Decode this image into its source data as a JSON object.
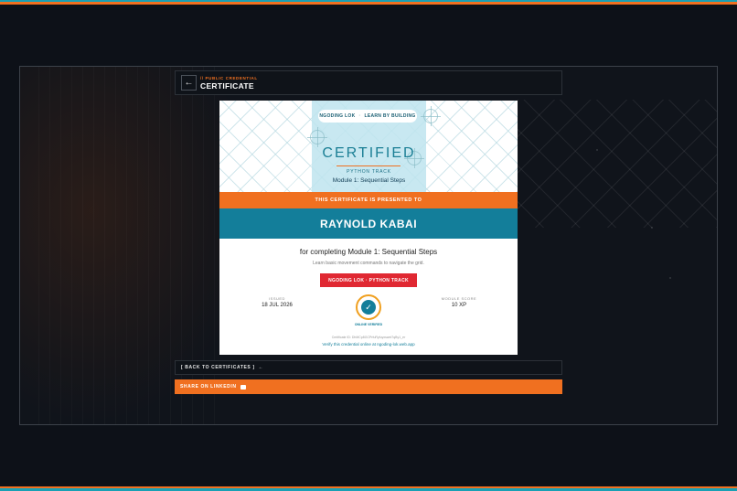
{
  "header": {
    "back_icon": "arrow-left-icon",
    "kicker": "// PUBLIC CREDENTIAL",
    "title": "CERTIFICATE"
  },
  "certificate": {
    "brand_name": "NGODING LOK",
    "brand_separator": "·",
    "brand_tagline": "LEARN BY BUILDING",
    "certified": "CERTIFIED",
    "track": "PYTHON TRACK",
    "module": "Module 1: Sequential Steps",
    "presented_to": "THIS CERTIFICATE IS PRESENTED TO",
    "recipient": "RAYNOLD KABAI",
    "completing": "for completing Module 1: Sequential Steps",
    "description": "Learn basic movement commands to navigate the grid.",
    "track_badge": "NGODING LOK · PYTHON TRACK",
    "issued_label": "ISSUED",
    "issued_value": "18 JUL 2026",
    "score_label": "MODULE SCORE",
    "score_value": "10 XP",
    "seal_icon": "verified-check-icon",
    "online_verified": "ONLINE VERIFIED",
    "certificate_id": "Certificate ID: DhMCp8GCPrfuRyfuyxswnt7qBy1_er",
    "verify_text": "Verify this credential online at ngoding-lok.web.app",
    "colors": {
      "orange": "#f07020",
      "teal": "#137e9a",
      "red": "#e02832",
      "gold": "#f0a020"
    }
  },
  "actions": {
    "back_to_certificates": "[ BACK TO CERTIFICATES ]",
    "back_icon": "arrow-left-icon",
    "share_linkedin": "SHARE ON LINKEDIN",
    "linkedin_icon": "briefcase-icon"
  }
}
